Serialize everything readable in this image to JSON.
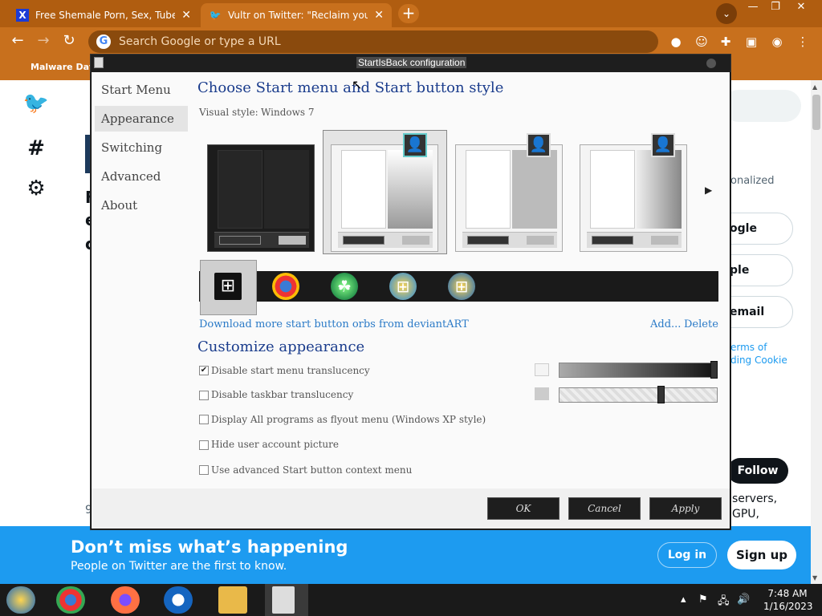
{
  "browser": {
    "tabs": [
      {
        "label": "Free Shemale Porn, Sex, Tube Vi",
        "favicon": "X",
        "active": false
      },
      {
        "label": "Vultr on Twitter: \"Reclaim your p",
        "favicon": "twitter-bird",
        "active": true
      }
    ],
    "new_tab": "+",
    "tab_menu": "⌄",
    "window_controls": [
      "—",
      "❐",
      "✕"
    ],
    "omnibox_placeholder": "Search Google or type a URL",
    "omnibox_g": "G",
    "bookmark": "Malware Datab",
    "colors": {
      "frame": "#b05d10",
      "toolbar": "#c8701d"
    }
  },
  "twitter": {
    "right_texts": [
      "onalized",
      "ogle",
      "ple",
      "email",
      "erms of",
      "ding Cookie",
      "Follow",
      "servers,",
      "GPU,"
    ],
    "left_texts": [
      "F",
      "e",
      "c",
      "9"
    ],
    "banner": {
      "headline": "Don’t miss what’s happening",
      "sub": "People on Twitter are the first to know.",
      "login": "Log in",
      "signup": "Sign up"
    },
    "brand_color": "#1d9bf0"
  },
  "dialog": {
    "title": "StartIsBack configuration",
    "nav": [
      "Start Menu",
      "Appearance",
      "Switching",
      "Advanced",
      "About"
    ],
    "selected_nav": "Appearance",
    "heading_style": "Choose Start menu and Start button style",
    "visual_style_label": "Visual style:",
    "visual_style_value": "Windows 7",
    "download_link": "Download more start button orbs from deviantART",
    "add_link": "Add...",
    "delete_link": "Delete",
    "heading_customize": "Customize appearance",
    "options": [
      {
        "label": "Disable start menu translucency",
        "checked": true
      },
      {
        "label": "Disable taskbar translucency",
        "checked": false
      },
      {
        "label": "Display All programs as flyout menu (Windows XP style)",
        "checked": false
      },
      {
        "label": "Hide user account picture",
        "checked": false
      },
      {
        "label": "Use advanced Start button context menu",
        "checked": false
      }
    ],
    "sliders": [
      {
        "name": "start-menu-opacity",
        "level": 1.0
      },
      {
        "name": "taskbar-opacity",
        "level": 0.65
      }
    ],
    "buttons": {
      "ok": "OK",
      "cancel": "Cancel",
      "apply": "Apply"
    },
    "check_mark": "✔"
  },
  "taskbar": {
    "time": "7:48 AM",
    "date": "1/16/2023",
    "icons": [
      "windows-orb-icon",
      "chrome-icon",
      "firefox-icon",
      "obama-logo-icon",
      "file-explorer-icon",
      "startisback-icon"
    ]
  }
}
